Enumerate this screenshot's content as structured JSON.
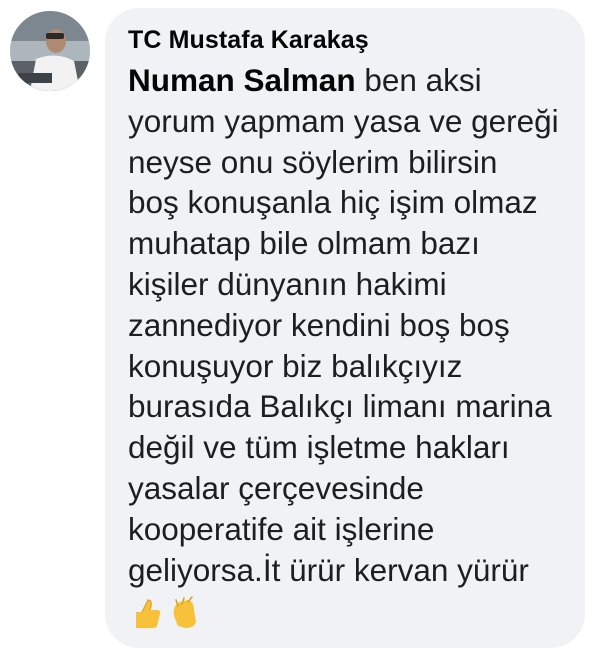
{
  "comment": {
    "author": "TC Mustafa Karakaş",
    "mention": "Numan Salman",
    "lines": [
      " ben aksi",
      "yorum yapmam yasa ve gereği",
      "neyse onu söylerim bilirsin",
      "boş konuşanla hiç işim olmaz",
      "muhatap bile olmam bazı",
      "kişiler dünyanın hakimi",
      "zannediyor kendini boş boş",
      "konuşuyor biz balıkçıyız",
      "burasıda Balıkçı limanı marina",
      "değil ve tüm işletme hakları",
      "yasalar çerçevesinde",
      "kooperatife ait işlerine",
      "geliyorsa.İt ürür kervan yürür"
    ],
    "emojis": [
      "thumbs-up-icon",
      "clapping-hands-icon"
    ]
  },
  "colors": {
    "bubble_bg": "#f0f2f5",
    "text": "#1c1e21",
    "author": "#050505",
    "emoji": "#f7c23a"
  }
}
